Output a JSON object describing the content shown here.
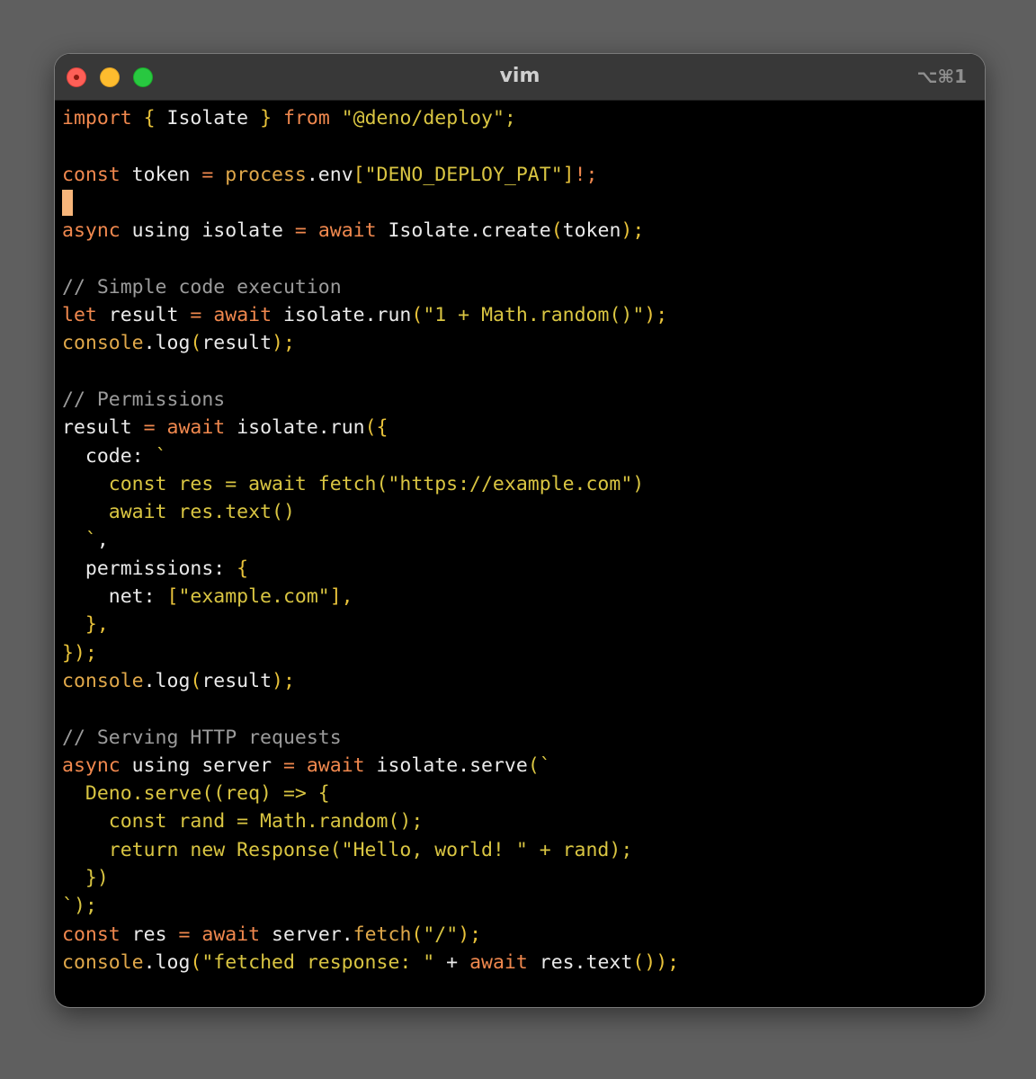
{
  "window": {
    "title": "vim",
    "shortcut": "⌥⌘1"
  },
  "colors": {
    "keyword": "#f0884e",
    "function": "#e0a84a",
    "string": "#d9c542",
    "comment": "#9b9b9b",
    "text": "#eaeaea",
    "cursor": "#f7b57a",
    "background": "#000000"
  },
  "code": {
    "l1": [
      "import",
      " ",
      "{",
      " Isolate ",
      "}",
      " ",
      "from",
      " ",
      "\"@deno/deploy\";"
    ],
    "l3": [
      "const",
      " token ",
      "=",
      " ",
      "process",
      ".env",
      "[",
      "\"DENO_DEPLOY_PAT\"",
      "]",
      "!;"
    ],
    "l5": [
      "async",
      " using isolate ",
      "=",
      " ",
      "await",
      " Isolate.create",
      "(",
      "token",
      ");"
    ],
    "l7": [
      "// Simple code execution"
    ],
    "l8": [
      "let",
      " result ",
      "=",
      " ",
      "await",
      " isolate.run",
      "(",
      "\"1 + Math.random()\"",
      ");"
    ],
    "l9": [
      "console",
      ".log",
      "(",
      "result",
      ");"
    ],
    "l11": [
      "// Permissions"
    ],
    "l12": [
      "result ",
      "=",
      " ",
      "await",
      " isolate.run",
      "({"
    ],
    "l13": [
      "  code: ",
      "`"
    ],
    "l14": [
      "    const res = await fetch(\"https://example.com\")"
    ],
    "l15": [
      "    await res.text()"
    ],
    "l16": [
      "  `",
      ","
    ],
    "l17": [
      "  permissions: ",
      "{"
    ],
    "l18": [
      "    net: ",
      "[",
      "\"example.com\"",
      "],"
    ],
    "l19": [
      "  ",
      "},"
    ],
    "l20": [
      "});"
    ],
    "l21": [
      "console",
      ".log",
      "(",
      "result",
      ");"
    ],
    "l23": [
      "// Serving HTTP requests"
    ],
    "l24": [
      "async",
      " using server ",
      "=",
      " ",
      "await",
      " isolate.serve",
      "(`"
    ],
    "l25": [
      "  Deno.serve((req) => {"
    ],
    "l26": [
      "    const rand = Math.random();"
    ],
    "l27": [
      "    return new Response(\"Hello, world! \" + rand);"
    ],
    "l28": [
      "  })"
    ],
    "l29": [
      "`);"
    ],
    "l30": [
      "const",
      " res ",
      "=",
      " ",
      "await",
      " server.",
      "fetch",
      "(",
      "\"/\"",
      ");"
    ],
    "l31": [
      "console",
      ".log",
      "(",
      "\"fetched response: \"",
      " + ",
      "await",
      " res.text",
      "());"
    ]
  }
}
